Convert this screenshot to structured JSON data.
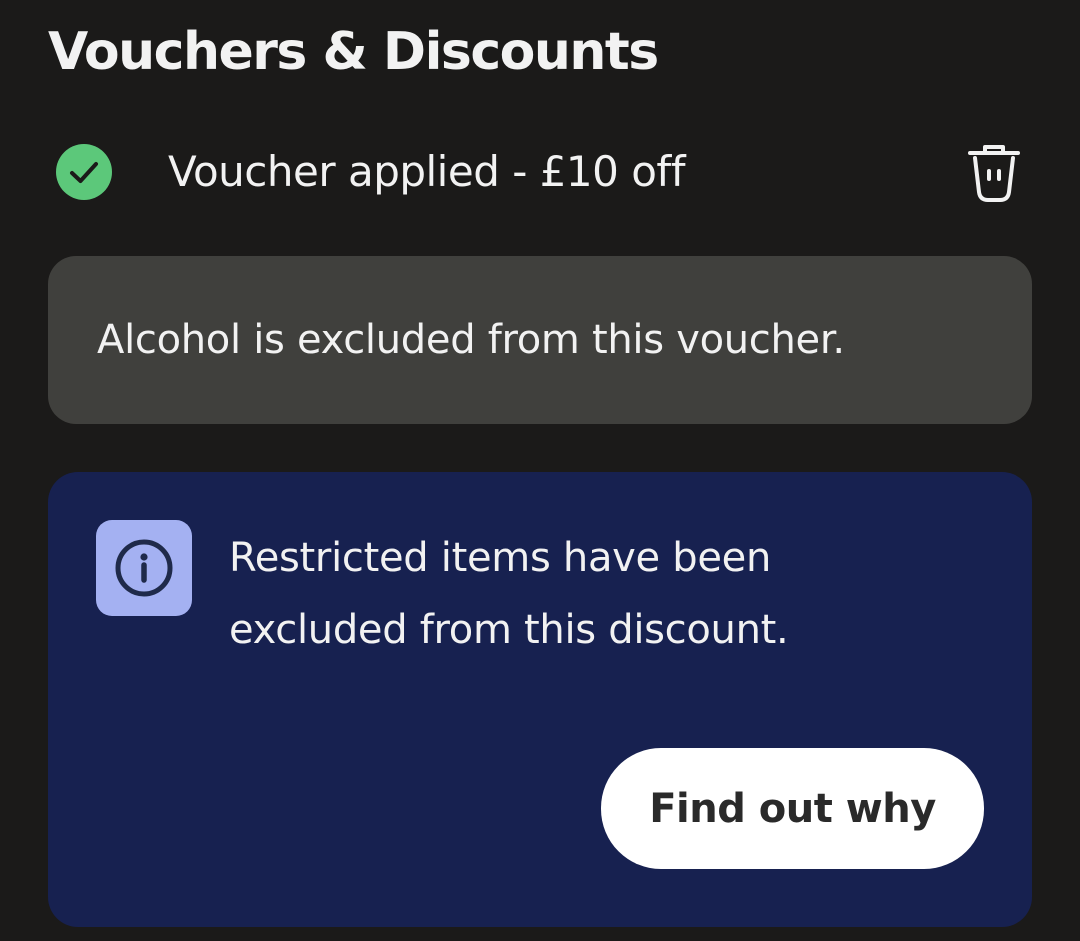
{
  "header": {
    "title": "Vouchers & Discounts"
  },
  "voucher": {
    "status_text": "Voucher applied - £10 off",
    "status_icon": "check-circle-icon",
    "remove_icon": "trash-icon"
  },
  "exclusion_notice": {
    "text": "Alcohol is excluded from this voucher."
  },
  "info_notice": {
    "icon": "info-icon",
    "text": "Restricted items have been excluded from this discount.",
    "button_label": "Find out why"
  },
  "colors": {
    "background": "#1b1a19",
    "success_green": "#5cc87a",
    "notice_grey": "#40403d",
    "info_navy": "#172150",
    "info_icon_bg": "#a4b1f2",
    "button_white": "#ffffff"
  }
}
